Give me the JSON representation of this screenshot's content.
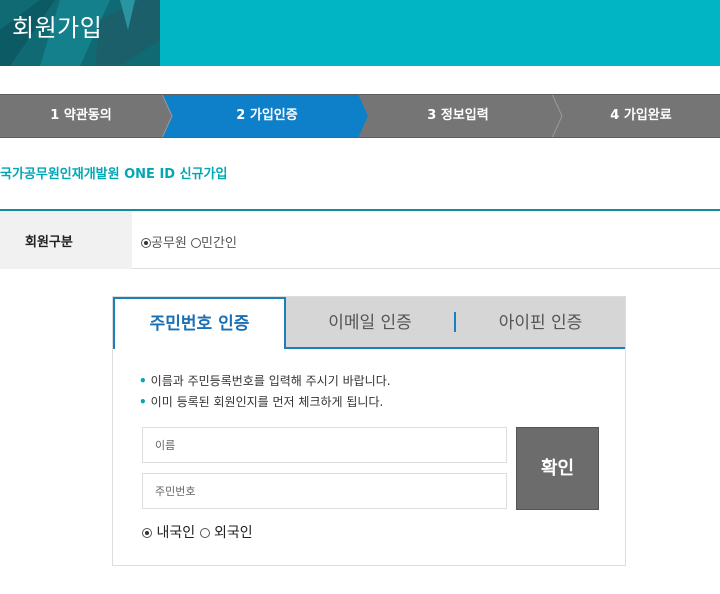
{
  "header": {
    "title": "회원가입"
  },
  "steps": [
    {
      "label": "1 약관동의",
      "active": false
    },
    {
      "label": "2 가입인증",
      "active": true
    },
    {
      "label": "3 정보입력",
      "active": false
    },
    {
      "label": "4 가입완료",
      "active": false
    }
  ],
  "subtitle": "국가공무원인재개발원 ONE ID 신규가입",
  "member_type": {
    "label": "회원구분",
    "options": [
      {
        "label": "공무원",
        "selected": true
      },
      {
        "label": "민간인",
        "selected": false
      }
    ]
  },
  "auth": {
    "tabs": [
      {
        "label": "주민번호 인증",
        "active": true
      },
      {
        "label": "이메일 인증",
        "active": false
      },
      {
        "label": "아이핀 인증",
        "active": false
      }
    ],
    "notes": [
      "이름과 주민등록번호를 입력해 주시기 바랍니다.",
      "이미 등록된 회원인지를 먼저 체크하게 됩니다."
    ],
    "name_placeholder": "이름",
    "rrn_placeholder": "주민번호",
    "confirm_label": "확인",
    "nationality": [
      {
        "label": "내국인",
        "selected": true
      },
      {
        "label": "외국인",
        "selected": false
      }
    ]
  },
  "colors": {
    "header": "#01b5c4",
    "active_step": "#0e7fc9",
    "step": "#757575",
    "accent": "#02a7b5",
    "tab_border": "#1a7fbf"
  }
}
